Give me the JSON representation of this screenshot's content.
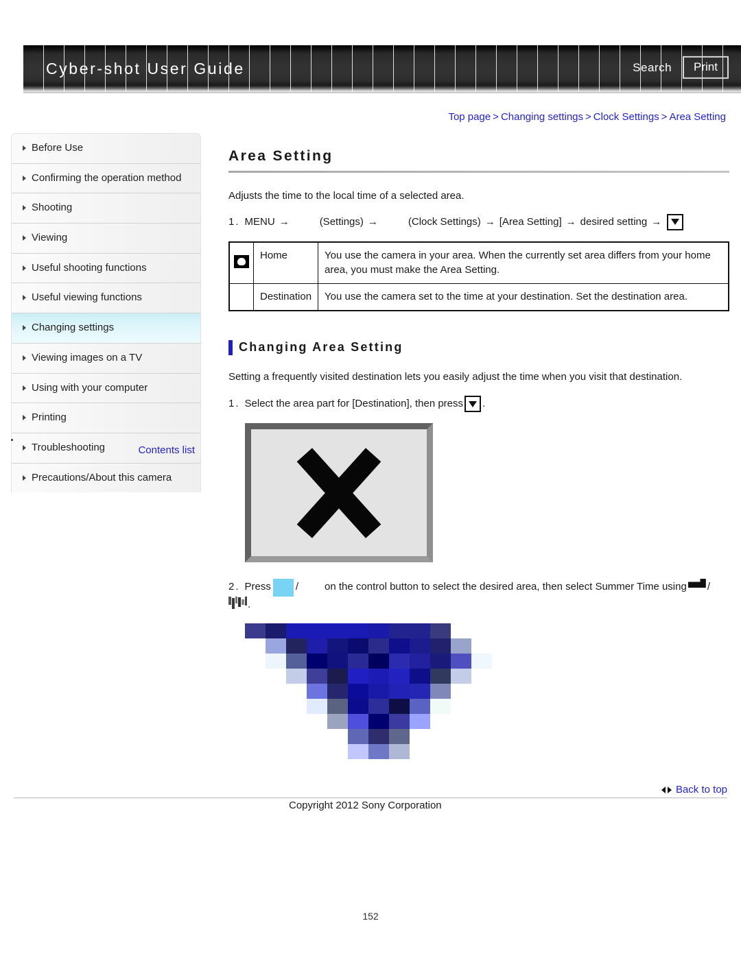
{
  "header": {
    "brand": "Cyber-shot User Guide",
    "search_label": "Search",
    "print_label": "Print"
  },
  "breadcrumb": {
    "items": [
      "Top page",
      "Changing settings",
      "Clock Settings",
      "Area Setting"
    ],
    "separator": ">"
  },
  "sidebar": {
    "items": [
      {
        "label": "Before Use",
        "active": false
      },
      {
        "label": "Confirming the operation method",
        "active": false
      },
      {
        "label": "Shooting",
        "active": false
      },
      {
        "label": "Viewing",
        "active": false
      },
      {
        "label": "Useful shooting functions",
        "active": false
      },
      {
        "label": "Useful viewing functions",
        "active": false
      },
      {
        "label": "Changing settings",
        "active": true
      },
      {
        "label": "Viewing images on a TV",
        "active": false
      },
      {
        "label": "Using with your computer",
        "active": false
      },
      {
        "label": "Printing",
        "active": false
      },
      {
        "label": "Troubleshooting",
        "active": false
      },
      {
        "label": "Precautions/About this camera",
        "active": false
      }
    ],
    "contents_link": "Contents list"
  },
  "main": {
    "title": "Area Setting",
    "lead": "Adjusts the time to the local time of a selected area.",
    "step1": {
      "number": "1.",
      "p1": "MENU",
      "p2": "(Settings)",
      "p3": "(Clock Settings)",
      "p4": "[Area Setting]",
      "p5": "desired setting",
      "arrow": "→",
      "end_button": "down-button-icon"
    },
    "table": {
      "rows": [
        {
          "icon": "home-icon",
          "label": "Home",
          "desc": "You use the camera in your area. When the currently set area differs from your home area, you must make the Area Setting."
        },
        {
          "icon": "",
          "label": "Destination",
          "desc": "You use the camera set to the time at your destination. Set the destination area."
        }
      ]
    },
    "subsection": {
      "heading": "Changing Area Setting",
      "intro": "Setting a frequently visited destination lets you easily adjust the time when you visit that destination.",
      "step1_number": "1.",
      "step1_text_before": "Select the area part for [Destination], then press",
      "step1_text_after": ".",
      "step2_number": "2.",
      "step2_text_a": "Press",
      "step2_slash": "/",
      "step2_text_b": "on the control button to select the desired area, then select Summer Time using",
      "step2_slash2": "/",
      "step2_text_c": "."
    }
  },
  "footer": {
    "back_to_top": "Back to top",
    "copyright": "Copyright 2012 Sony Corporation",
    "page_number": "152"
  },
  "colors": {
    "link": "#2323c8",
    "accent_bar": "#2020c0",
    "active_nav": "#c9eff5",
    "header_dark": "#2b2b2b",
    "placeholder_blue": "#79d3f2"
  }
}
